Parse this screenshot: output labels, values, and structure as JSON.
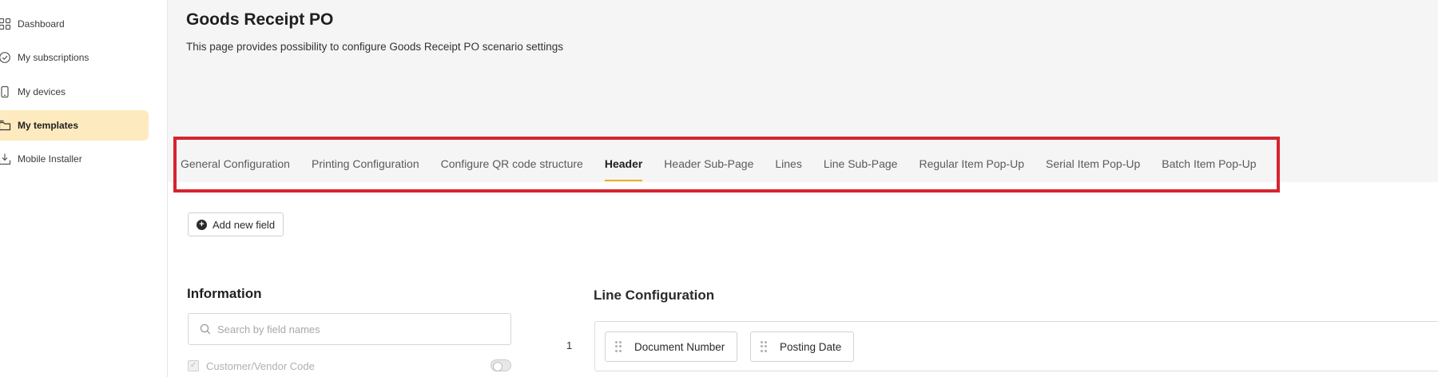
{
  "sidebar": {
    "items": [
      {
        "label": "Dashboard",
        "icon": "grid-icon"
      },
      {
        "label": "My subscriptions",
        "icon": "check-circle-icon"
      },
      {
        "label": "My devices",
        "icon": "phone-icon"
      },
      {
        "label": "My templates",
        "icon": "template-icon",
        "active": true
      },
      {
        "label": "Mobile Installer",
        "icon": "download-tray-icon"
      }
    ]
  },
  "header": {
    "title": "Goods Receipt PO",
    "description": "This page provides possibility to configure Goods Receipt PO scenario settings"
  },
  "tabs": [
    {
      "label": "General Configuration"
    },
    {
      "label": "Printing Configuration"
    },
    {
      "label": "Configure QR code structure"
    },
    {
      "label": "Header",
      "active": true
    },
    {
      "label": "Header Sub-Page"
    },
    {
      "label": "Lines"
    },
    {
      "label": "Line Sub-Page"
    },
    {
      "label": "Regular Item Pop-Up"
    },
    {
      "label": "Serial Item Pop-Up"
    },
    {
      "label": "Batch Item Pop-Up"
    }
  ],
  "toolbar": {
    "add_field_label": "Add new field"
  },
  "information": {
    "title": "Information",
    "search_placeholder": "Search by field names",
    "fields": [
      {
        "label": "Customer/Vendor Code"
      }
    ]
  },
  "line_configuration": {
    "title": "Line Configuration",
    "rows": [
      {
        "number": "1",
        "fields": [
          "Document Number",
          "Posting Date"
        ]
      }
    ]
  },
  "colors": {
    "active_nav_bg": "#fdebbf",
    "tab_underline": "#e8b01a",
    "highlight_border": "#d6242f"
  }
}
